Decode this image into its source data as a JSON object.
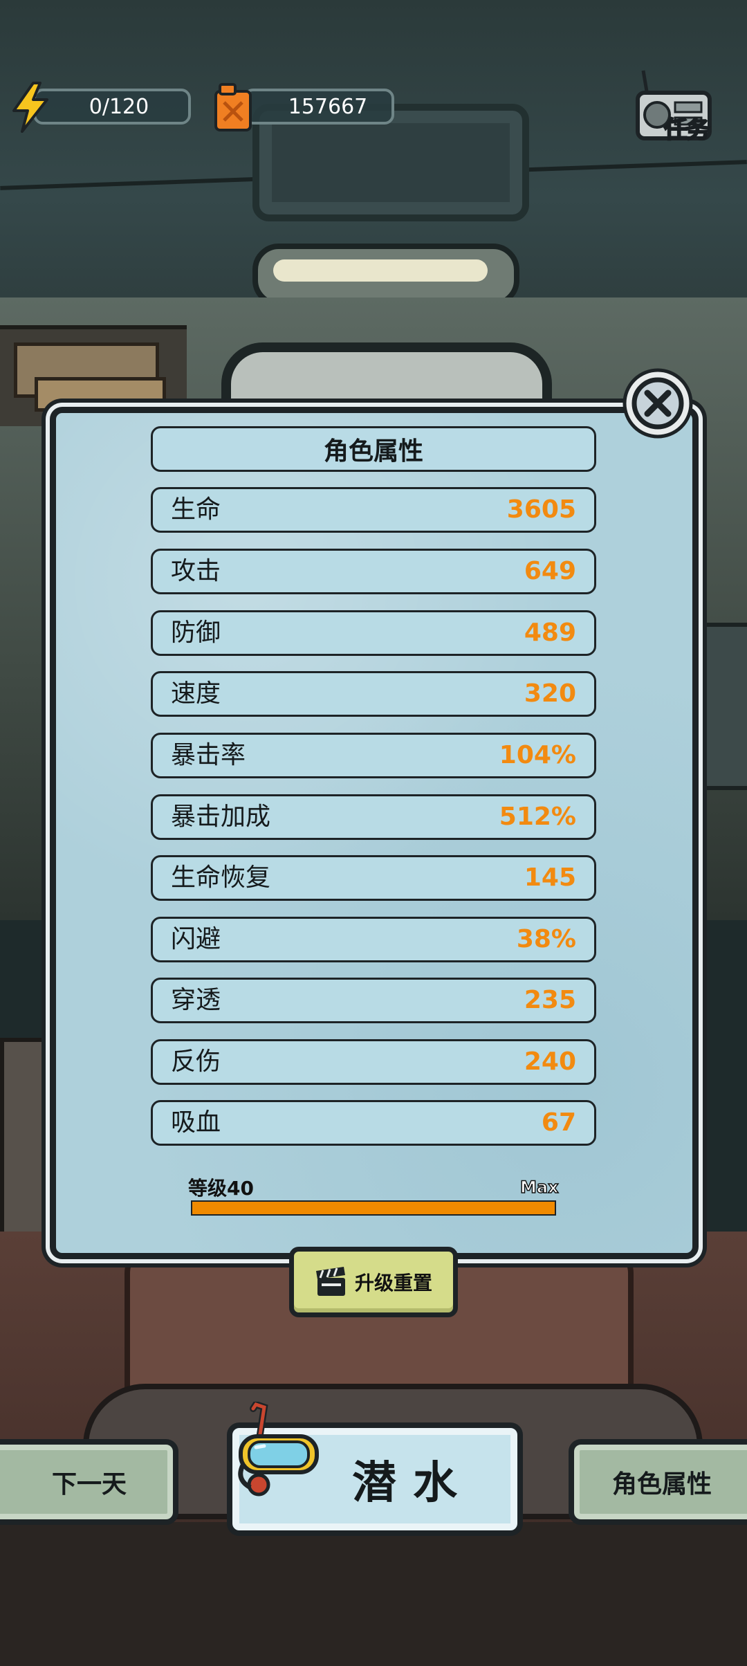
{
  "hud": {
    "energy": "0/120",
    "fuel": "157667",
    "task_label": "任务"
  },
  "panel": {
    "title": "角色属性",
    "stats": [
      {
        "name": "生命",
        "value": "3605"
      },
      {
        "name": "攻击",
        "value": "649"
      },
      {
        "name": "防御",
        "value": "489"
      },
      {
        "name": "速度",
        "value": "320"
      },
      {
        "name": "暴击率",
        "value": "104%"
      },
      {
        "name": "暴击加成",
        "value": "512%"
      },
      {
        "name": "生命恢复",
        "value": "145"
      },
      {
        "name": "闪避",
        "value": "38%"
      },
      {
        "name": "穿透",
        "value": "235"
      },
      {
        "name": "反伤",
        "value": "240"
      },
      {
        "name": "吸血",
        "value": "67"
      }
    ],
    "level_label": "等级40",
    "max_label": "Max",
    "level_progress": 1.0,
    "reset_label": "升级重置"
  },
  "bottom": {
    "next_day": "下一天",
    "dive": "潜水",
    "attributes": "角色属性"
  },
  "colors": {
    "stat_value": "#f28a10",
    "panel_bg": "#aed0db",
    "level_bar": "#f08a00"
  },
  "icons": [
    "bolt-icon",
    "fuel-can-icon",
    "radio-icon",
    "close-icon",
    "clapperboard-icon",
    "diving-mask-icon"
  ]
}
